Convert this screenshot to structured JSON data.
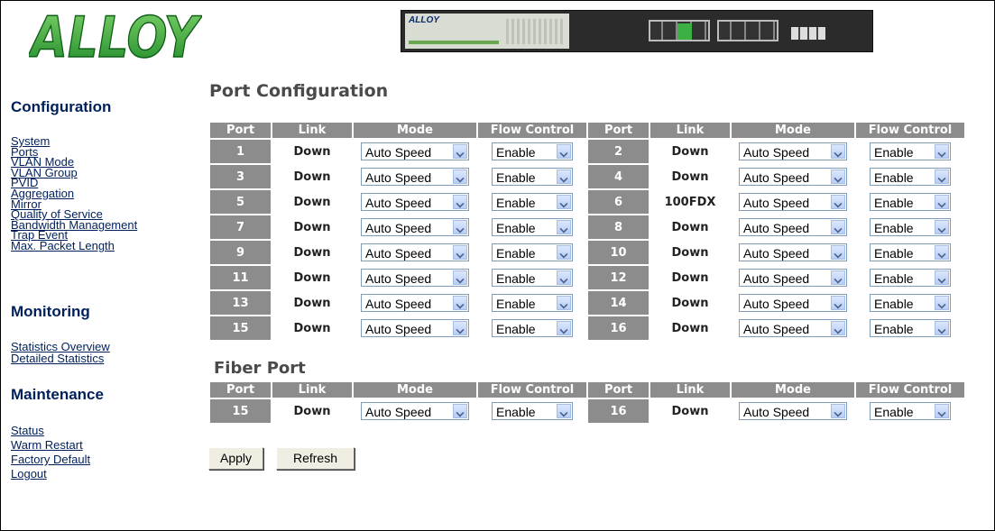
{
  "brand": {
    "logo_text": "ALLOY",
    "device_label": "ALLOY"
  },
  "sidebar": {
    "configuration": {
      "title": "Configuration",
      "items": [
        "System",
        "Ports",
        "VLAN Mode",
        "VLAN Group",
        "PVID",
        "Aggregation",
        "Mirror",
        "Quality of Service",
        "Bandwidth Management",
        "Trap Event",
        "Max. Packet Length"
      ]
    },
    "monitoring": {
      "title": "Monitoring",
      "items": [
        "Statistics Overview",
        "Detailed Statistics"
      ]
    },
    "maintenance": {
      "title": "Maintenance",
      "items": [
        "Status",
        "Warm Restart",
        "Factory Default",
        "Logout"
      ]
    }
  },
  "main": {
    "title": "Port Configuration",
    "fiber_title": "Fiber Port",
    "headers": [
      "Port",
      "Link",
      "Mode",
      "Flow Control",
      "Port",
      "Link",
      "Mode",
      "Flow Control"
    ],
    "rows": [
      {
        "l": {
          "port": "1",
          "link": "Down",
          "mode": "Auto Speed",
          "flow": "Enable"
        },
        "r": {
          "port": "2",
          "link": "Down",
          "mode": "Auto Speed",
          "flow": "Enable"
        }
      },
      {
        "l": {
          "port": "3",
          "link": "Down",
          "mode": "Auto Speed",
          "flow": "Enable"
        },
        "r": {
          "port": "4",
          "link": "Down",
          "mode": "Auto Speed",
          "flow": "Enable"
        }
      },
      {
        "l": {
          "port": "5",
          "link": "Down",
          "mode": "Auto Speed",
          "flow": "Enable"
        },
        "r": {
          "port": "6",
          "link": "100FDX",
          "mode": "Auto Speed",
          "flow": "Enable"
        }
      },
      {
        "l": {
          "port": "7",
          "link": "Down",
          "mode": "Auto Speed",
          "flow": "Enable"
        },
        "r": {
          "port": "8",
          "link": "Down",
          "mode": "Auto Speed",
          "flow": "Enable"
        }
      },
      {
        "l": {
          "port": "9",
          "link": "Down",
          "mode": "Auto Speed",
          "flow": "Enable"
        },
        "r": {
          "port": "10",
          "link": "Down",
          "mode": "Auto Speed",
          "flow": "Enable"
        }
      },
      {
        "l": {
          "port": "11",
          "link": "Down",
          "mode": "Auto Speed",
          "flow": "Enable"
        },
        "r": {
          "port": "12",
          "link": "Down",
          "mode": "Auto Speed",
          "flow": "Enable"
        }
      },
      {
        "l": {
          "port": "13",
          "link": "Down",
          "mode": "Auto Speed",
          "flow": "Enable"
        },
        "r": {
          "port": "14",
          "link": "Down",
          "mode": "Auto Speed",
          "flow": "Enable"
        }
      },
      {
        "l": {
          "port": "15",
          "link": "Down",
          "mode": "Auto Speed",
          "flow": "Enable"
        },
        "r": {
          "port": "16",
          "link": "Down",
          "mode": "Auto Speed",
          "flow": "Enable"
        }
      }
    ],
    "fiber_rows": [
      {
        "l": {
          "port": "15",
          "link": "Down",
          "mode": "Auto Speed",
          "flow": "Enable"
        },
        "r": {
          "port": "16",
          "link": "Down",
          "mode": "Auto Speed",
          "flow": "Enable"
        }
      }
    ],
    "buttons": {
      "apply": "Apply",
      "refresh": "Refresh"
    }
  },
  "colors": {
    "nav": "#00205b",
    "header_cell": "#8c8c8c",
    "logo_green": "#3aa935"
  }
}
